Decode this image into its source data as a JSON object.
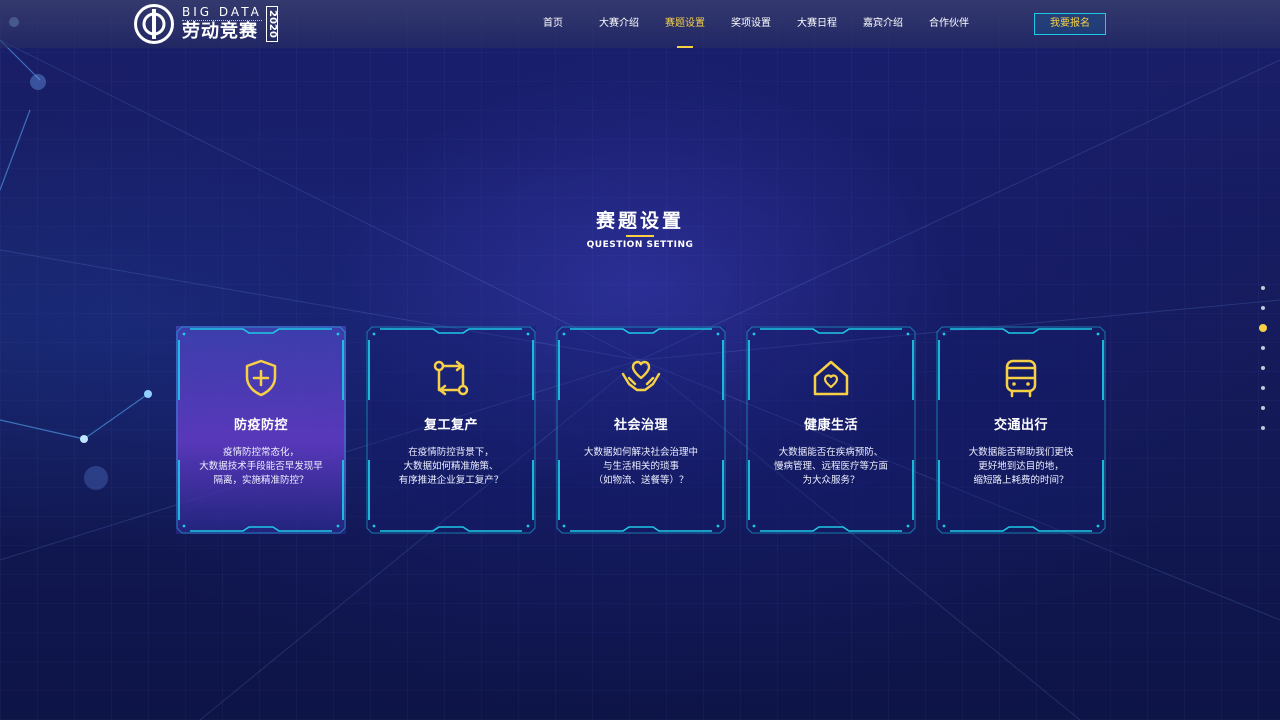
{
  "header": {
    "logo": {
      "en": "BIG DATA",
      "cn": "劳动竞赛",
      "year": "2020"
    },
    "nav": [
      {
        "label": "首页",
        "active": false
      },
      {
        "label": "大赛介绍",
        "active": false
      },
      {
        "label": "赛题设置",
        "active": true
      },
      {
        "label": "奖项设置",
        "active": false
      },
      {
        "label": "大赛日程",
        "active": false
      },
      {
        "label": "嘉宾介绍",
        "active": false
      },
      {
        "label": "合作伙伴",
        "active": false
      }
    ],
    "signup_label": "我要报名"
  },
  "section": {
    "title": "赛题设置",
    "subtitle": "QUESTION SETTING"
  },
  "cards": [
    {
      "icon": "shield-plus-icon",
      "title": "防疫防控",
      "lines": [
        "疫情防控常态化，",
        "大数据技术手段能否早发现早",
        "隔离，实施精准防控？"
      ],
      "highlighted": true
    },
    {
      "icon": "cycle-arrows-icon",
      "title": "复工复产",
      "lines": [
        "在疫情防控背景下，",
        "大数据如何精准施策、",
        "有序推进企业复工复产？"
      ],
      "highlighted": false
    },
    {
      "icon": "heart-hands-icon",
      "title": "社会治理",
      "lines": [
        "大数据如何解决社会治理中",
        "与生活相关的琐事",
        "（如物流、送餐等）？"
      ],
      "highlighted": false
    },
    {
      "icon": "house-heart-icon",
      "title": "健康生活",
      "lines": [
        "大数据能否在疾病预防、",
        "慢病管理、远程医疗等方面",
        "为大众服务？"
      ],
      "highlighted": false
    },
    {
      "icon": "bus-icon",
      "title": "交通出行",
      "lines": [
        "大数据能否帮助我们更快",
        "更好地到达目的地，",
        "缩短路上耗费的时间？"
      ],
      "highlighted": false
    }
  ],
  "pager": {
    "count": 8,
    "active_index": 2
  },
  "colors": {
    "accent": "#f7d046",
    "frame": "#1ec8e6",
    "background": "#151b5c"
  }
}
